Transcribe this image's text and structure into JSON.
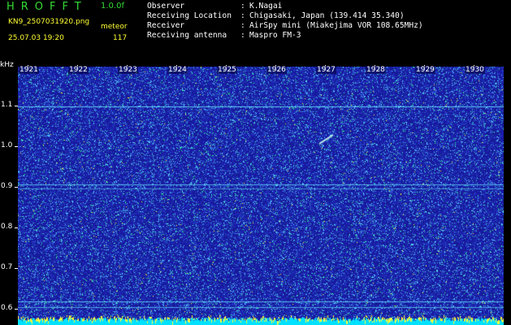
{
  "header": {
    "app_title": "HROFFT",
    "version": "1.0.0f",
    "file_name": "KN9_2507031920.png",
    "mode": "meteor",
    "datetime": "25.07.03 19:20",
    "count": "117",
    "info": [
      {
        "label": "Observer",
        "sep": ":",
        "value": "K.Nagai"
      },
      {
        "label": "Receiving Location",
        "sep": ":",
        "value": "Chigasaki, Japan (139.414 35.340)"
      },
      {
        "label": "Receiver",
        "sep": ":",
        "value": "AirSpy mini (Miakejima VOR 108.65MHz)"
      },
      {
        "label": "Receiving antenna",
        "sep": ":",
        "value": "Maspro FM-3"
      }
    ]
  },
  "spectrogram": {
    "unit_label": "kHz",
    "time_labels": [
      "1921",
      "1922",
      "1923",
      "1924",
      "1925",
      "1926",
      "1927",
      "1928",
      "1929",
      "1930"
    ],
    "freq_labels": [
      "1.1",
      "1.0",
      "0.9",
      "0.8",
      "0.7",
      "0.6"
    ],
    "colors": {
      "background": "#1a1aa8",
      "noise_light": "#5ad0ff",
      "noise_green": "#33ff99",
      "noise_yellow": "#ffff33",
      "carrier_line": "#66ddff",
      "bottom_band": "#00e0ff"
    }
  }
}
